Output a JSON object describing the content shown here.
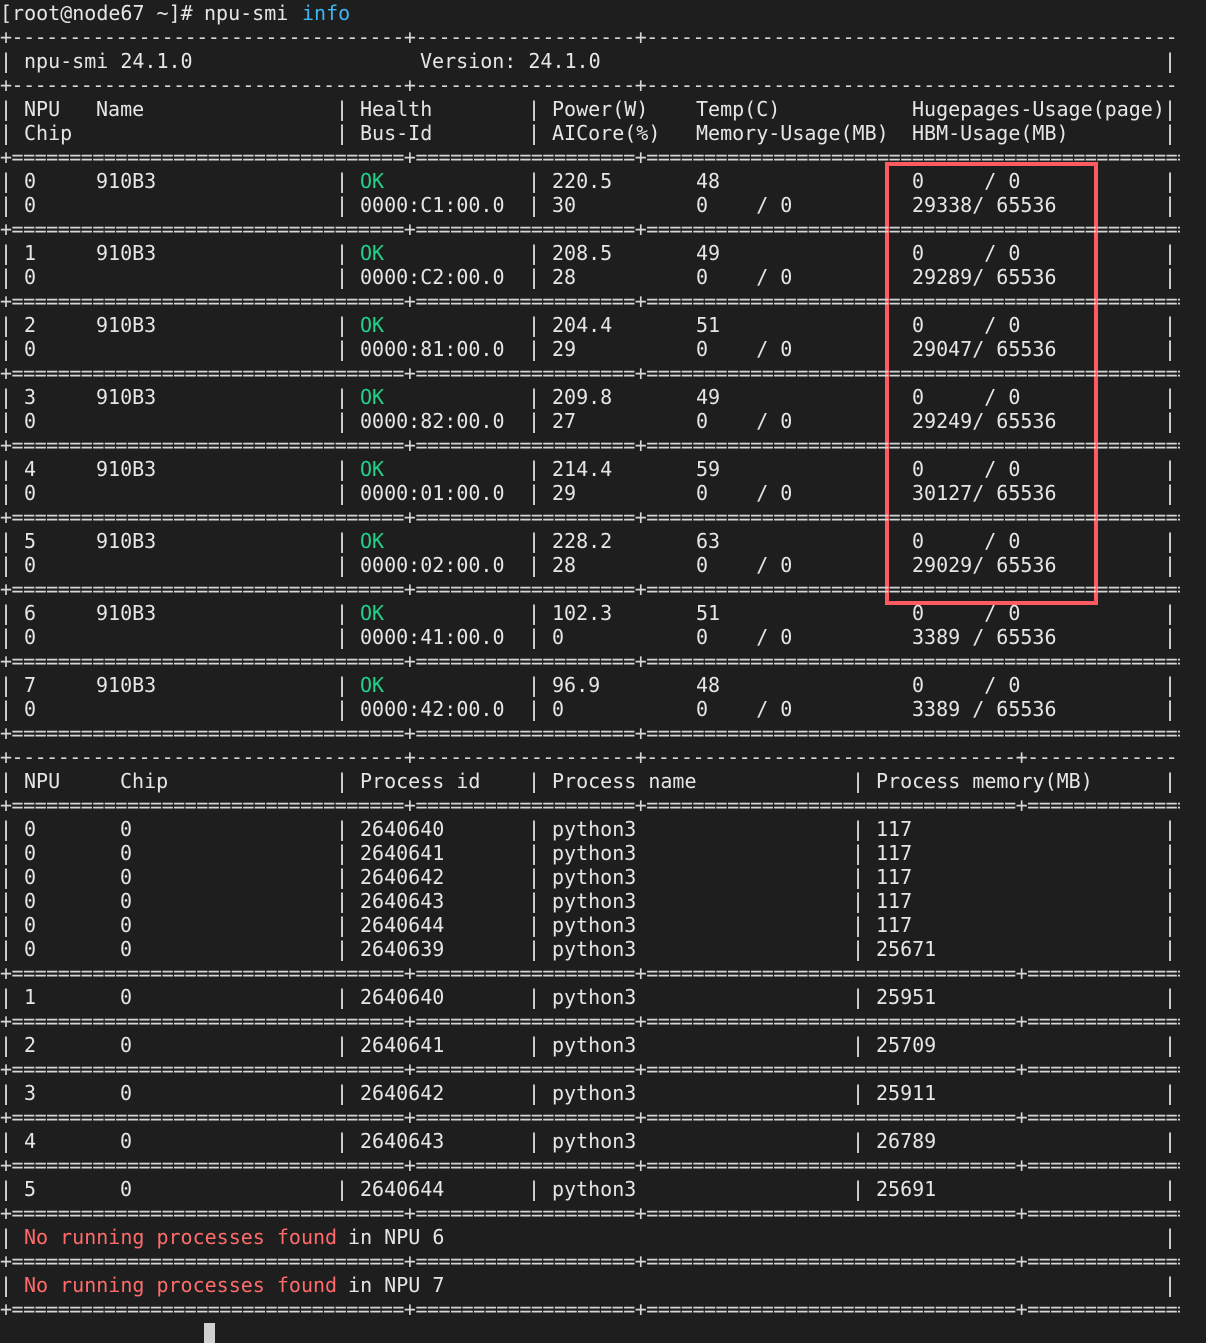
{
  "prompt": {
    "user_host": "[root@node67 ~]# ",
    "command": "npu-smi ",
    "argument": "info"
  },
  "header": {
    "tool": "npu-smi 24.1.0",
    "version_label": "Version: 24.1.0"
  },
  "device_table": {
    "col_headers_row1": [
      "NPU",
      "Name",
      "Health",
      "Power(W)",
      "Temp(C)",
      "Hugepages-Usage(page)"
    ],
    "col_headers_row2": [
      "Chip",
      "Bus-Id",
      "AICore(%)",
      "Memory-Usage(MB)",
      "HBM-Usage(MB)"
    ],
    "rows": [
      {
        "npu": "0",
        "name": "910B3",
        "health": "OK",
        "power": "220.5",
        "temp": "48",
        "huge": "0     / 0",
        "chip": "0",
        "bus": "0000:C1:00.0",
        "aicore": "30",
        "mem": "0    / 0",
        "hbm": "29338/ 65536"
      },
      {
        "npu": "1",
        "name": "910B3",
        "health": "OK",
        "power": "208.5",
        "temp": "49",
        "huge": "0     / 0",
        "chip": "0",
        "bus": "0000:C2:00.0",
        "aicore": "28",
        "mem": "0    / 0",
        "hbm": "29289/ 65536"
      },
      {
        "npu": "2",
        "name": "910B3",
        "health": "OK",
        "power": "204.4",
        "temp": "51",
        "huge": "0     / 0",
        "chip": "0",
        "bus": "0000:81:00.0",
        "aicore": "29",
        "mem": "0    / 0",
        "hbm": "29047/ 65536"
      },
      {
        "npu": "3",
        "name": "910B3",
        "health": "OK",
        "power": "209.8",
        "temp": "49",
        "huge": "0     / 0",
        "chip": "0",
        "bus": "0000:82:00.0",
        "aicore": "27",
        "mem": "0    / 0",
        "hbm": "29249/ 65536"
      },
      {
        "npu": "4",
        "name": "910B3",
        "health": "OK",
        "power": "214.4",
        "temp": "59",
        "huge": "0     / 0",
        "chip": "0",
        "bus": "0000:01:00.0",
        "aicore": "29",
        "mem": "0    / 0",
        "hbm": "30127/ 65536"
      },
      {
        "npu": "5",
        "name": "910B3",
        "health": "OK",
        "power": "228.2",
        "temp": "63",
        "huge": "0     / 0",
        "chip": "0",
        "bus": "0000:02:00.0",
        "aicore": "28",
        "mem": "0    / 0",
        "hbm": "29029/ 65536"
      },
      {
        "npu": "6",
        "name": "910B3",
        "health": "OK",
        "power": "102.3",
        "temp": "51",
        "huge": "0     / 0",
        "chip": "0",
        "bus": "0000:41:00.0",
        "aicore": "0",
        "mem": "0    / 0",
        "hbm": "3389 / 65536"
      },
      {
        "npu": "7",
        "name": "910B3",
        "health": "OK",
        "power": "96.9",
        "temp": "48",
        "huge": "0     / 0",
        "chip": "0",
        "bus": "0000:42:00.0",
        "aicore": "0",
        "mem": "0    / 0",
        "hbm": "3389 / 65536"
      }
    ]
  },
  "process_table": {
    "col_headers": [
      "NPU",
      "Chip",
      "Process id",
      "Process name",
      "Process memory(MB)"
    ],
    "groups": [
      [
        {
          "npu": "0",
          "chip": "0",
          "pid": "2640640",
          "name": "python3",
          "mem": "117"
        },
        {
          "npu": "0",
          "chip": "0",
          "pid": "2640641",
          "name": "python3",
          "mem": "117"
        },
        {
          "npu": "0",
          "chip": "0",
          "pid": "2640642",
          "name": "python3",
          "mem": "117"
        },
        {
          "npu": "0",
          "chip": "0",
          "pid": "2640643",
          "name": "python3",
          "mem": "117"
        },
        {
          "npu": "0",
          "chip": "0",
          "pid": "2640644",
          "name": "python3",
          "mem": "117"
        },
        {
          "npu": "0",
          "chip": "0",
          "pid": "2640639",
          "name": "python3",
          "mem": "25671"
        }
      ],
      [
        {
          "npu": "1",
          "chip": "0",
          "pid": "2640640",
          "name": "python3",
          "mem": "25951"
        }
      ],
      [
        {
          "npu": "2",
          "chip": "0",
          "pid": "2640641",
          "name": "python3",
          "mem": "25709"
        }
      ],
      [
        {
          "npu": "3",
          "chip": "0",
          "pid": "2640642",
          "name": "python3",
          "mem": "25911"
        }
      ],
      [
        {
          "npu": "4",
          "chip": "0",
          "pid": "2640643",
          "name": "python3",
          "mem": "26789"
        }
      ],
      [
        {
          "npu": "5",
          "chip": "0",
          "pid": "2640644",
          "name": "python3",
          "mem": "25691"
        }
      ]
    ],
    "no_process": [
      {
        "msg": "No running processes found",
        "suffix": " in NPU 6"
      },
      {
        "msg": "No running processes found",
        "suffix": " in NPU 7"
      }
    ]
  },
  "colors": {
    "ok": "#23d18b",
    "warning_text": "#ff6b6b",
    "highlight_box": "#ff5a5f",
    "argument": "#3fb6f2"
  }
}
